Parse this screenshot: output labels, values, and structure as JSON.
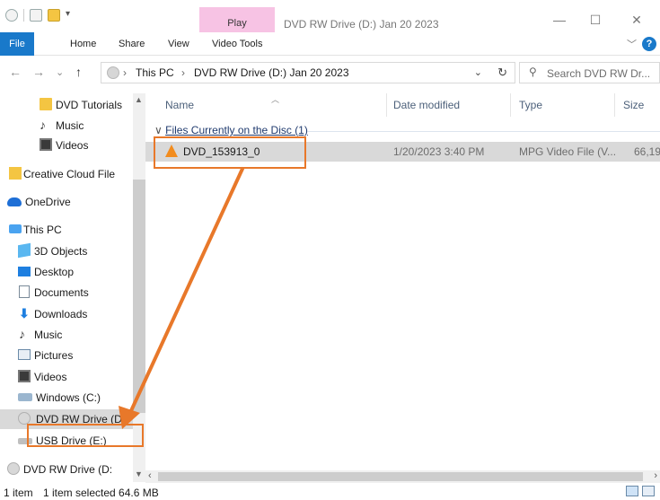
{
  "window": {
    "title": "DVD RW Drive (D:) Jan 20 2023",
    "context_tab_group": "Play",
    "controls": {
      "minimize": "—",
      "maximize": "☐",
      "close": "✕"
    }
  },
  "ribbon": {
    "tabs": [
      "File",
      "Home",
      "Share",
      "View",
      "Video Tools"
    ],
    "help": "?",
    "collapse": "﹀"
  },
  "address": {
    "crumbs": [
      "This PC",
      "DVD RW Drive (D:) Jan 20 2023"
    ],
    "separator": "›",
    "dropdown": "⌄",
    "refresh": "↻",
    "nav": {
      "back": "←",
      "forward": "→",
      "recent": "⌄",
      "up": "↑"
    }
  },
  "search": {
    "placeholder": "Search DVD RW Dr...",
    "icon": "⚲"
  },
  "sidebar": {
    "items": [
      {
        "label": "DVD Tutorials",
        "icon": "folder-icon"
      },
      {
        "label": "Music",
        "icon": "music-icon"
      },
      {
        "label": "Videos",
        "icon": "videos-icon"
      },
      {
        "label": "Creative Cloud File",
        "icon": "creative-cloud-icon"
      },
      {
        "label": "OneDrive",
        "icon": "onedrive-icon"
      },
      {
        "label": "This PC",
        "icon": "this-pc-icon"
      },
      {
        "label": "3D Objects",
        "icon": "3d-objects-icon"
      },
      {
        "label": "Desktop",
        "icon": "desktop-icon"
      },
      {
        "label": "Documents",
        "icon": "documents-icon"
      },
      {
        "label": "Downloads",
        "icon": "downloads-icon"
      },
      {
        "label": "Music",
        "icon": "music-icon"
      },
      {
        "label": "Pictures",
        "icon": "pictures-icon"
      },
      {
        "label": "Videos",
        "icon": "videos-icon"
      },
      {
        "label": "Windows (C:)",
        "icon": "windows-drive-icon"
      },
      {
        "label": "DVD RW Drive (D",
        "icon": "dvd-drive-icon",
        "selected": true
      },
      {
        "label": "USB Drive (E:)",
        "icon": "usb-drive-icon"
      },
      {
        "label": "DVD RW Drive (D:",
        "icon": "dvd-drive-icon"
      }
    ]
  },
  "columns": [
    "Name",
    "Date modified",
    "Type",
    "Size"
  ],
  "group": {
    "label": "Files Currently on the Disc (1)",
    "chevron": "∨"
  },
  "files": [
    {
      "name": "DVD_153913_0",
      "date_modified": "1/20/2023 3:40 PM",
      "type": "MPG Video File (V...",
      "size": "66,19"
    }
  ],
  "status": {
    "count": "1 item",
    "selection": "1 item selected  64.6 MB"
  },
  "colors": {
    "accent": "#1979ca",
    "annotation": "#e8782a",
    "context_tab": "#f7c3e4"
  }
}
